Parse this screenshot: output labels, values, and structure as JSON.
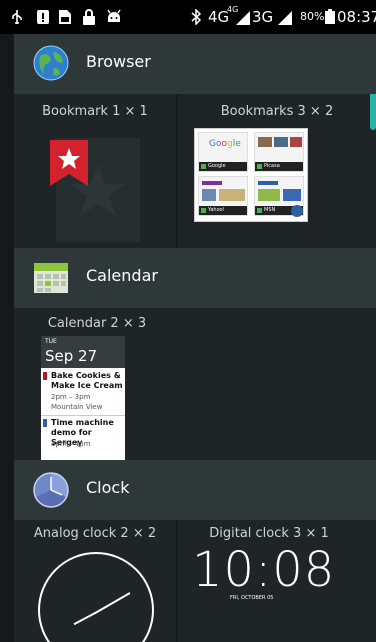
{
  "status_bar": {
    "network_label": "4G",
    "network_sup": "4G",
    "network2_label": "3G",
    "battery": "80%",
    "time": "08:37"
  },
  "browser": {
    "title": "Browser",
    "widgets": [
      {
        "label": "Bookmark 1 × 1"
      },
      {
        "label": "Bookmarks 3 × 2"
      }
    ],
    "thumbs": [
      "Google",
      "Picasa",
      "Yahoo!",
      "MSN"
    ]
  },
  "calendar": {
    "title": "Calendar",
    "widget_label": "Calendar 2 × 3",
    "day_of_week": "TUE",
    "date": "Sep 27",
    "events": [
      {
        "title": "Bake Cookies & Make Ice Cream",
        "time": "2pm – 3pm",
        "place": "Mountain View",
        "color": "#b5162b"
      },
      {
        "title": "Time machine demo for Sergey",
        "time": "3pm – 4pm",
        "place": "",
        "color": "#3d5a9e"
      }
    ]
  },
  "clock": {
    "title": "Clock",
    "widgets": [
      {
        "label": "Analog clock 2 × 2"
      },
      {
        "label": "Digital clock 3 × 1"
      }
    ],
    "digital_time": "10:08",
    "digital_date": "FRI, OCTOBER 05",
    "analog_time": "10:08"
  },
  "colors": {
    "panel": "#1f2526",
    "header": "#2f3839",
    "accent": "#2bb3a7"
  }
}
